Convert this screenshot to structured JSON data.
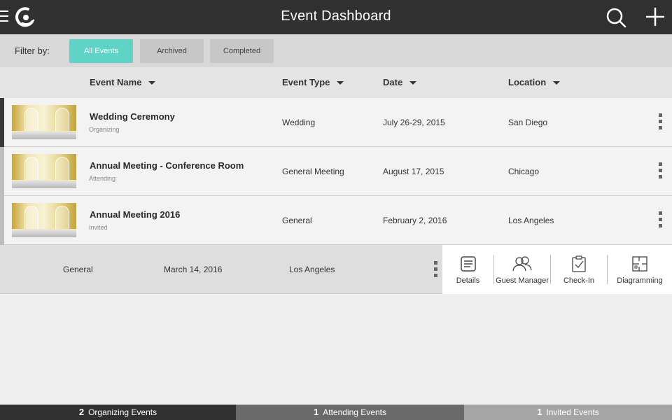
{
  "header": {
    "title": "Event Dashboard",
    "menu_icon": "hamburger-icon",
    "logo_icon": "app-logo",
    "search_icon": "search-icon",
    "add_icon": "plus-icon"
  },
  "filter": {
    "label": "Filter by:",
    "buttons": [
      {
        "label": "All Events",
        "active": true
      },
      {
        "label": "Archived",
        "active": false
      },
      {
        "label": "Completed",
        "active": false
      }
    ],
    "accent_color": "#5fd3c5"
  },
  "columns": [
    {
      "label": "Event Name"
    },
    {
      "label": "Event Type"
    },
    {
      "label": "Date"
    },
    {
      "label": "Location"
    }
  ],
  "events": [
    {
      "name": "Wedding Ceremony",
      "role": "Organizing",
      "type": "Wedding",
      "date": "July 26-29, 2015",
      "location": "San Diego"
    },
    {
      "name": "Annual Meeting - Conference Room",
      "role": "Attending",
      "type": "General Meeting",
      "date": "August 17, 2015",
      "location": "Chicago"
    },
    {
      "name": "Annual Meeting 2016",
      "role": "Invited",
      "type": "General",
      "date": "February 2, 2016",
      "location": "Los Angeles"
    }
  ],
  "expanded_event": {
    "type": "General",
    "date": "March 14, 2016",
    "location": "Los Angeles",
    "actions": [
      {
        "label": "Details",
        "icon": "details-icon"
      },
      {
        "label": "Guest Manager",
        "icon": "guests-icon"
      },
      {
        "label": "Check-In",
        "icon": "checkin-icon"
      },
      {
        "label": "Diagramming",
        "icon": "floorplan-icon"
      }
    ]
  },
  "footer": {
    "tabs": [
      {
        "count": "2",
        "label": "Organizing Events",
        "bg": "#303030",
        "fg": "#ffffff"
      },
      {
        "count": "1",
        "label": "Attending Events",
        "bg": "#6a6a6a",
        "fg": "#ffffff"
      },
      {
        "count": "1",
        "label": "Invited Events",
        "bg": "#a5a5a5",
        "fg": "#ffffff"
      }
    ]
  }
}
